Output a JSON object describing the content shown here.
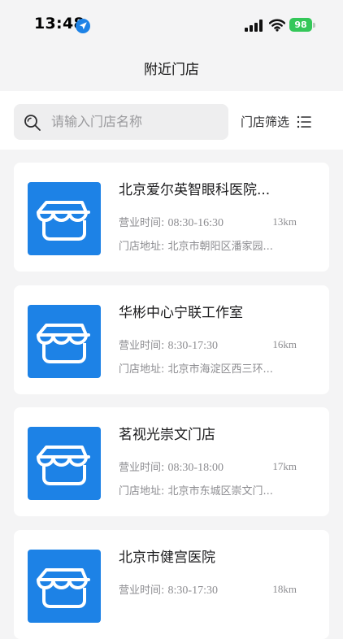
{
  "status_bar": {
    "time": "13:48",
    "battery": "98"
  },
  "page": {
    "title": "附近门店"
  },
  "search": {
    "placeholder": "请输入门店名称"
  },
  "filter": {
    "label": "门店筛选"
  },
  "stores": [
    {
      "name": "北京爱尔英智眼科医院...",
      "hours_label": "营业时间:",
      "hours": "08:30-16:30",
      "distance": "13km",
      "address": "门店地址: 北京市朝阳区潘家园..."
    },
    {
      "name": "华彬中心宁联工作室",
      "hours_label": "营业时间:",
      "hours": "8:30-17:30",
      "distance": "16km",
      "address": "门店地址: 北京市海淀区西三环..."
    },
    {
      "name": "茗视光崇文门店",
      "hours_label": "营业时间:",
      "hours": "08:30-18:00",
      "distance": "17km",
      "address": "门店地址: 北京市东城区崇文门..."
    },
    {
      "name": "北京市健宫医院",
      "hours_label": "营业时间:",
      "hours": "8:30-17:30",
      "distance": "18km",
      "address": ""
    }
  ],
  "icons": {
    "location": "location-arrow-icon",
    "signal": "cellular-signal-icon",
    "wifi": "wifi-icon",
    "search": "search-icon",
    "filter": "list-filter-icon",
    "store": "store-icon"
  },
  "colors": {
    "accent": "#1d82e6",
    "battery": "#34c759",
    "background": "#f4f4f5",
    "card": "#ffffff"
  }
}
